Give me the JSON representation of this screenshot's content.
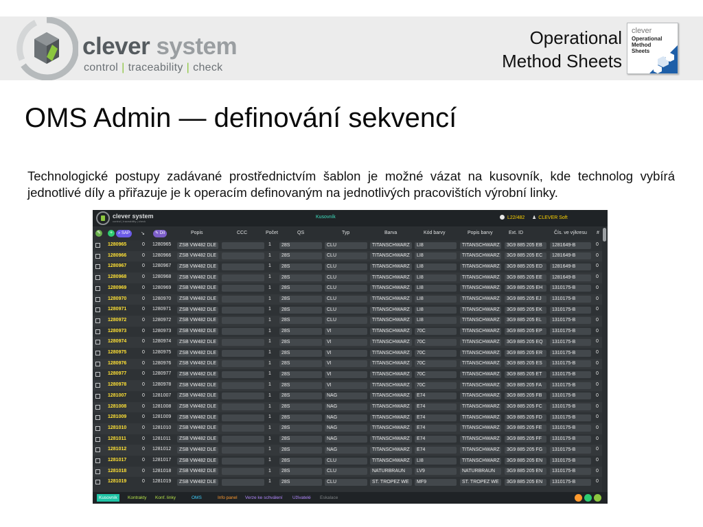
{
  "brand": {
    "word1": "clever",
    "word2": "system",
    "tag1": "control",
    "tag2": "traceability",
    "tag3": "check",
    "sep": "|"
  },
  "oms": {
    "title_line1": "Operational",
    "title_line2": "Method Sheets",
    "badge_top": "clever",
    "badge_l1": "Operational",
    "badge_l2": "Method",
    "badge_l3": "Sheets"
  },
  "slide": {
    "title": "OMS Admin — definování sekvencí",
    "text": "Technologické postupy zadávané prostřednictvím šablon je možné vázat na kusovník, kde technolog vybírá jednotlivé díly a přiřazuje je k operacím definovaným na jednotlivých pracovištích výrobní linky."
  },
  "app": {
    "brand": "clever system",
    "brand_sub": "control | traceability | check",
    "view_title": "Kusovník",
    "line": "L22/482",
    "user": "CLEVER Soft",
    "toolbar": {
      "add_icon": "+",
      "sap_label": "SAP",
      "sort_icon": "↘",
      "dil_label": "Díl"
    },
    "columns": [
      "Popis",
      "CCC",
      "Počet",
      "QS",
      "Typ",
      "Barva",
      "Kód barvy",
      "Popis barvy",
      "Ext. ID",
      "Čís. ve výkresu",
      "#"
    ],
    "rows": [
      [
        "1280965",
        "0",
        "1280965",
        "ZSB VW482 DLE",
        "",
        "1",
        "28S",
        "CLU",
        "TITANSCHWARZ",
        "LI8",
        "TITANSCHWARZ",
        "3G9 885 205 EB",
        "1281649-B",
        "0"
      ],
      [
        "1280966",
        "0",
        "1280966",
        "ZSB VW482 DLE",
        "",
        "1",
        "28S",
        "CLU",
        "TITANSCHWARZ",
        "LI8",
        "TITANSCHWARZ",
        "3G9 885 205 EC",
        "1281649-B",
        "0"
      ],
      [
        "1280967",
        "0",
        "1280967",
        "ZSB VW482 DLE",
        "",
        "1",
        "28S",
        "CLU",
        "TITANSCHWARZ",
        "LI8",
        "TITANSCHWARZ",
        "3G9 885 205 ED",
        "1281649-B",
        "0"
      ],
      [
        "1280968",
        "0",
        "1280968",
        "ZSB VW482 DLE",
        "",
        "1",
        "28S",
        "CLU",
        "TITANSCHWARZ",
        "LI8",
        "TITANSCHWARZ",
        "3G9 885 205 EE",
        "1281649-B",
        "0"
      ],
      [
        "1280969",
        "0",
        "1280969",
        "ZSB VW482 DLE",
        "",
        "1",
        "28S",
        "CLU",
        "TITANSCHWARZ",
        "LI8",
        "TITANSCHWARZ",
        "3G9 885 205 EH",
        "1310175-B",
        "0"
      ],
      [
        "1280970",
        "0",
        "1280970",
        "ZSB VW482 DLE",
        "",
        "1",
        "28S",
        "CLU",
        "TITANSCHWARZ",
        "LI8",
        "TITANSCHWARZ",
        "3G9 885 205 EJ",
        "1310175-B",
        "0"
      ],
      [
        "1280971",
        "0",
        "1280971",
        "ZSB VW482 DLE",
        "",
        "1",
        "28S",
        "CLU",
        "TITANSCHWARZ",
        "LI8",
        "TITANSCHWARZ",
        "3G9 885 205 EK",
        "1310175-B",
        "0"
      ],
      [
        "1280972",
        "0",
        "1280972",
        "ZSB VW482 DLE",
        "",
        "1",
        "28S",
        "CLU",
        "TITANSCHWARZ",
        "LI8",
        "TITANSCHWARZ",
        "3G9 885 205 EL",
        "1310175-B",
        "0"
      ],
      [
        "1280973",
        "0",
        "1280973",
        "ZSB VW482 DLE",
        "",
        "1",
        "28S",
        "VI",
        "TITANSCHWARZ",
        "70C",
        "TITANSCHWARZ",
        "3G9 885 205 EP",
        "1310175-B",
        "0"
      ],
      [
        "1280974",
        "0",
        "1280974",
        "ZSB VW482 DLE",
        "",
        "1",
        "28S",
        "VI",
        "TITANSCHWARZ",
        "70C",
        "TITANSCHWARZ",
        "3G9 885 205 EQ",
        "1310175-B",
        "0"
      ],
      [
        "1280975",
        "0",
        "1280975",
        "ZSB VW482 DLE",
        "",
        "1",
        "28S",
        "VI",
        "TITANSCHWARZ",
        "70C",
        "TITANSCHWARZ",
        "3G9 885 205 ER",
        "1310175-B",
        "0"
      ],
      [
        "1280976",
        "0",
        "1280976",
        "ZSB VW482 DLE",
        "",
        "1",
        "28S",
        "VI",
        "TITANSCHWARZ",
        "70C",
        "TITANSCHWARZ",
        "3G9 885 205 ES",
        "1310175-B",
        "0"
      ],
      [
        "1280977",
        "0",
        "1280977",
        "ZSB VW482 DLE",
        "",
        "1",
        "28S",
        "VI",
        "TITANSCHWARZ",
        "70C",
        "TITANSCHWARZ",
        "3G9 885 205 ET",
        "1310175-B",
        "0"
      ],
      [
        "1280978",
        "0",
        "1280978",
        "ZSB VW482 DLE",
        "",
        "1",
        "28S",
        "VI",
        "TITANSCHWARZ",
        "70C",
        "TITANSCHWARZ",
        "3G9 885 205 FA",
        "1310175-B",
        "0"
      ],
      [
        "1281007",
        "0",
        "1281007",
        "ZSB VW482 DLE",
        "",
        "1",
        "28S",
        "NAG",
        "TITANSCHWARZ",
        "E74",
        "TITANSCHWARZ",
        "3G9 885 205 FB",
        "1310175-B",
        "0"
      ],
      [
        "1281008",
        "0",
        "1281008",
        "ZSB VW482 DLE",
        "",
        "1",
        "28S",
        "NAG",
        "TITANSCHWARZ",
        "E74",
        "TITANSCHWARZ",
        "3G9 885 205 FC",
        "1310175-B",
        "0"
      ],
      [
        "1281009",
        "0",
        "1281009",
        "ZSB VW482 DLE",
        "",
        "1",
        "28S",
        "NAG",
        "TITANSCHWARZ",
        "E74",
        "TITANSCHWARZ",
        "3G9 885 205 FD",
        "1310175-B",
        "0"
      ],
      [
        "1281010",
        "0",
        "1281010",
        "ZSB VW482 DLE",
        "",
        "1",
        "28S",
        "NAG",
        "TITANSCHWARZ",
        "E74",
        "TITANSCHWARZ",
        "3G9 885 205 FE",
        "1310175-B",
        "0"
      ],
      [
        "1281011",
        "0",
        "1281011",
        "ZSB VW482 DLE",
        "",
        "1",
        "28S",
        "NAG",
        "TITANSCHWARZ",
        "E74",
        "TITANSCHWARZ",
        "3G9 885 205 FF",
        "1310175-B",
        "0"
      ],
      [
        "1281012",
        "0",
        "1281012",
        "ZSB VW482 DLE",
        "",
        "1",
        "28S",
        "NAG",
        "TITANSCHWARZ",
        "E74",
        "TITANSCHWARZ",
        "3G9 885 205 FG",
        "1310175-B",
        "0"
      ],
      [
        "1281017",
        "0",
        "1281017",
        "ZSB VW482 DLE",
        "",
        "1",
        "28S",
        "CLU",
        "TITANSCHWARZ",
        "LI8",
        "TITANSCHWARZ",
        "3G9 885 205 EN",
        "1310175-B",
        "0"
      ],
      [
        "1281018",
        "0",
        "1281018",
        "ZSB VW482 DLE",
        "",
        "1",
        "28S",
        "CLU",
        "NATURBRAUN",
        "LV9",
        "NATURBRAUN",
        "3G9 885 205 EN",
        "1310175-B",
        "0"
      ],
      [
        "1281019",
        "0",
        "1281019",
        "ZSB VW482 DLE",
        "",
        "1",
        "28S",
        "CLU",
        "ST. TROPEZ WE",
        "MF9",
        "ST. TROPEZ WE",
        "3G9 885 205 EN",
        "1310175-B",
        "0"
      ]
    ],
    "tabs": [
      {
        "label": "Kusovník",
        "color": "#ffffff",
        "active": true
      },
      {
        "label": "Kontrakty",
        "color": "#b7e34a"
      },
      {
        "label": "Konf. linky",
        "color": "#b7e34a"
      },
      {
        "label": "OMS",
        "color": "#3fd0ff"
      },
      {
        "label": "Info panel",
        "color": "#ff9a2e"
      },
      {
        "label": "Verze ke schválení",
        "color": "#b389ff"
      },
      {
        "label": "Uživatelé",
        "color": "#b389ff"
      },
      {
        "label": "Eskalace",
        "color": "#7d8184"
      }
    ]
  }
}
